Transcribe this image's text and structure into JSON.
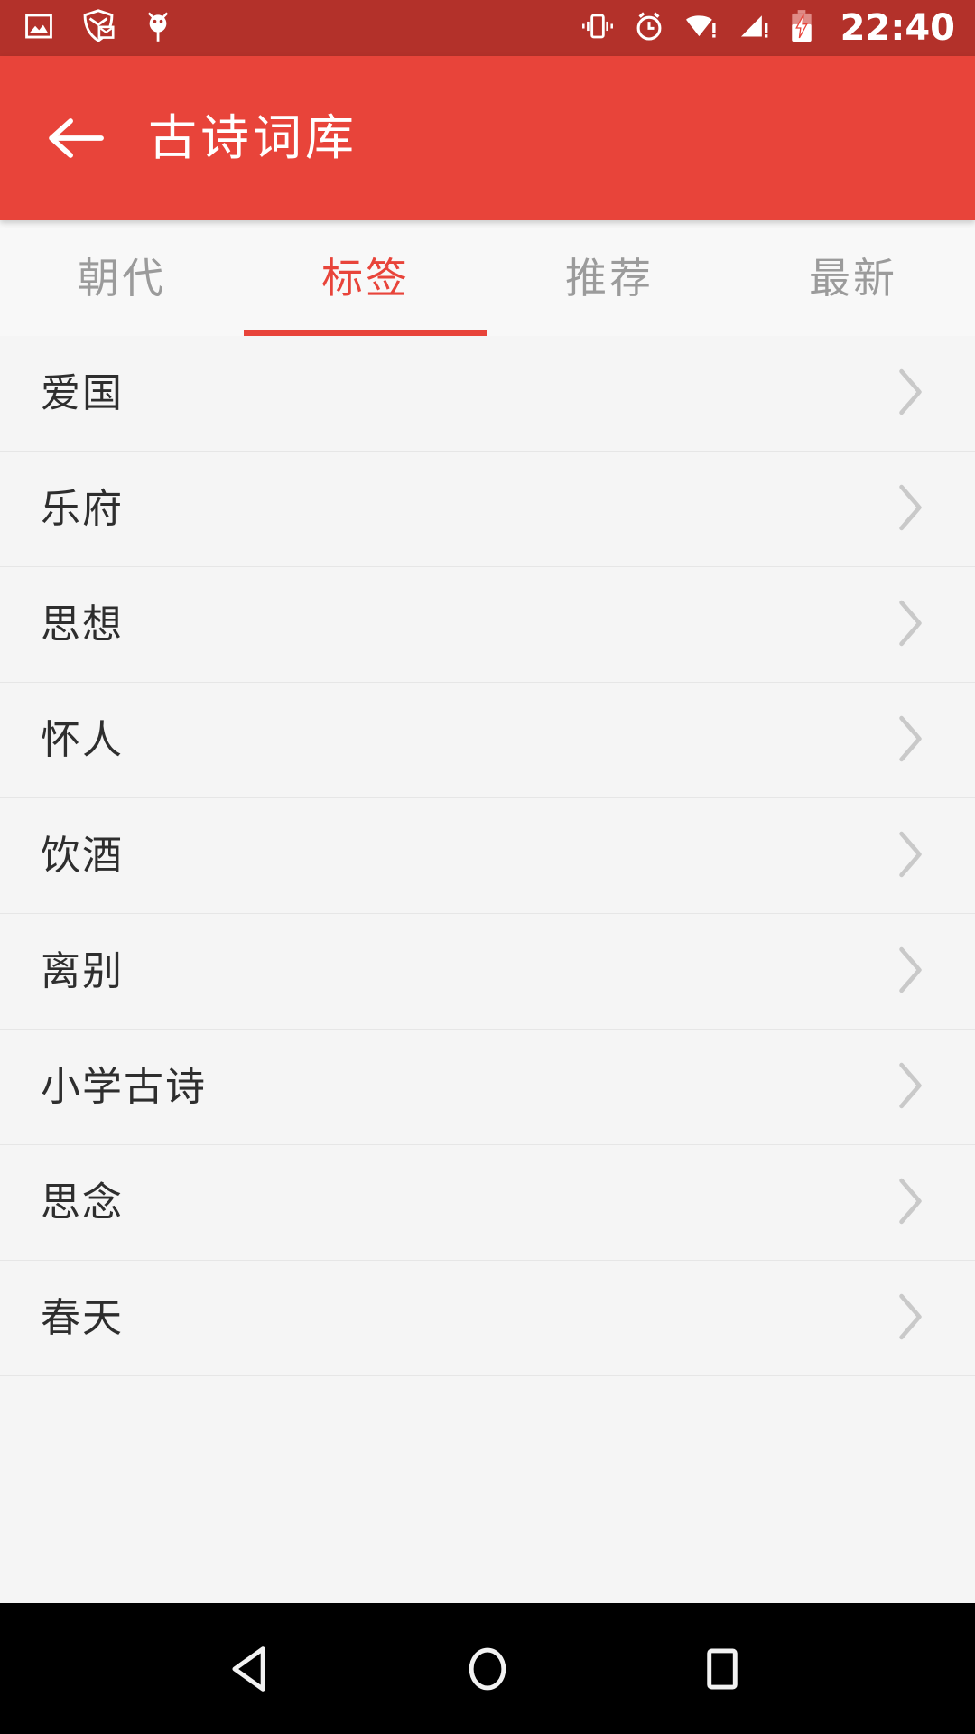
{
  "status_bar": {
    "background_color": "#b3312a",
    "icons": [
      {
        "name": "image-icon",
        "label": "screenshot"
      },
      {
        "name": "mail-shield-icon",
        "label": "secure-mail"
      },
      {
        "name": "bug-icon",
        "label": "debug"
      },
      {
        "name": "vibrate-icon",
        "label": "vibrate"
      },
      {
        "name": "alarm-icon",
        "label": "alarm"
      },
      {
        "name": "wifi-warning-icon",
        "label": "wifi-no-internet"
      },
      {
        "name": "signal-warning-icon",
        "label": "cellular-no-service"
      },
      {
        "name": "battery-charging-icon",
        "label": "battery-charging"
      }
    ],
    "time": "22:40"
  },
  "app_bar": {
    "background_color": "#e8443a",
    "back_label": "返回",
    "title": "古诗词库"
  },
  "tabs": {
    "active_index": 1,
    "active_color": "#e8443a",
    "inactive_color": "#9b9b9b",
    "items": [
      {
        "label": "朝代"
      },
      {
        "label": "标签"
      },
      {
        "label": "推荐"
      },
      {
        "label": "最新"
      }
    ]
  },
  "list": {
    "items": [
      {
        "label": "爱国"
      },
      {
        "label": "乐府"
      },
      {
        "label": "思想"
      },
      {
        "label": "怀人"
      },
      {
        "label": "饮酒"
      },
      {
        "label": "离别"
      },
      {
        "label": "小学古诗"
      },
      {
        "label": "思念"
      },
      {
        "label": "春天"
      }
    ]
  },
  "nav_bar": {
    "background_color": "#000000",
    "buttons": [
      {
        "name": "back",
        "label": "返回"
      },
      {
        "name": "home",
        "label": "主页"
      },
      {
        "name": "recents",
        "label": "最近任务"
      }
    ]
  }
}
